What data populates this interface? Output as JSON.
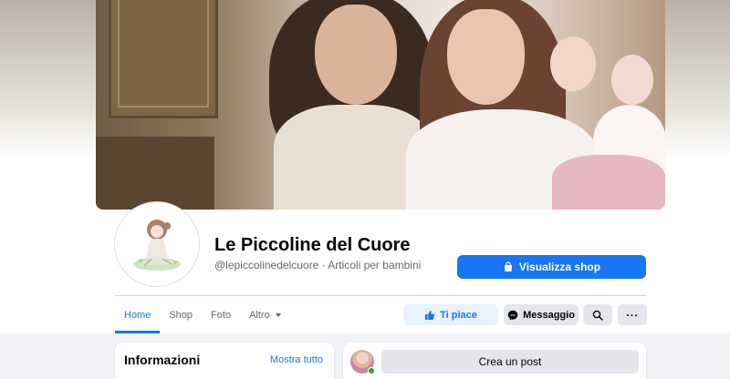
{
  "page": {
    "name": "Le Piccoline del Cuore",
    "username": "@lepiccolinedelcuore",
    "category": "Articoli per bambini",
    "subtitle": "@lepiccolinedelcuore · Articoli per bambini"
  },
  "actions": {
    "shop_label": "Visualizza shop",
    "like_label": "Ti piace",
    "message_label": "Messaggio",
    "search_icon": "search-icon",
    "more_label": "···"
  },
  "tabs": [
    {
      "label": "Home",
      "active": true
    },
    {
      "label": "Shop",
      "active": false
    },
    {
      "label": "Foto",
      "active": false
    },
    {
      "label": "Altro",
      "active": false
    }
  ],
  "info_card": {
    "title": "Informazioni",
    "link": "Mostra tutto"
  },
  "post_card": {
    "create_label": "Crea un post"
  },
  "colors": {
    "accent": "#1877f2",
    "accent_light": "#e7f3ff",
    "button_gray": "#e4e6eb",
    "online": "#31a24c",
    "background": "#f0f2f5"
  }
}
